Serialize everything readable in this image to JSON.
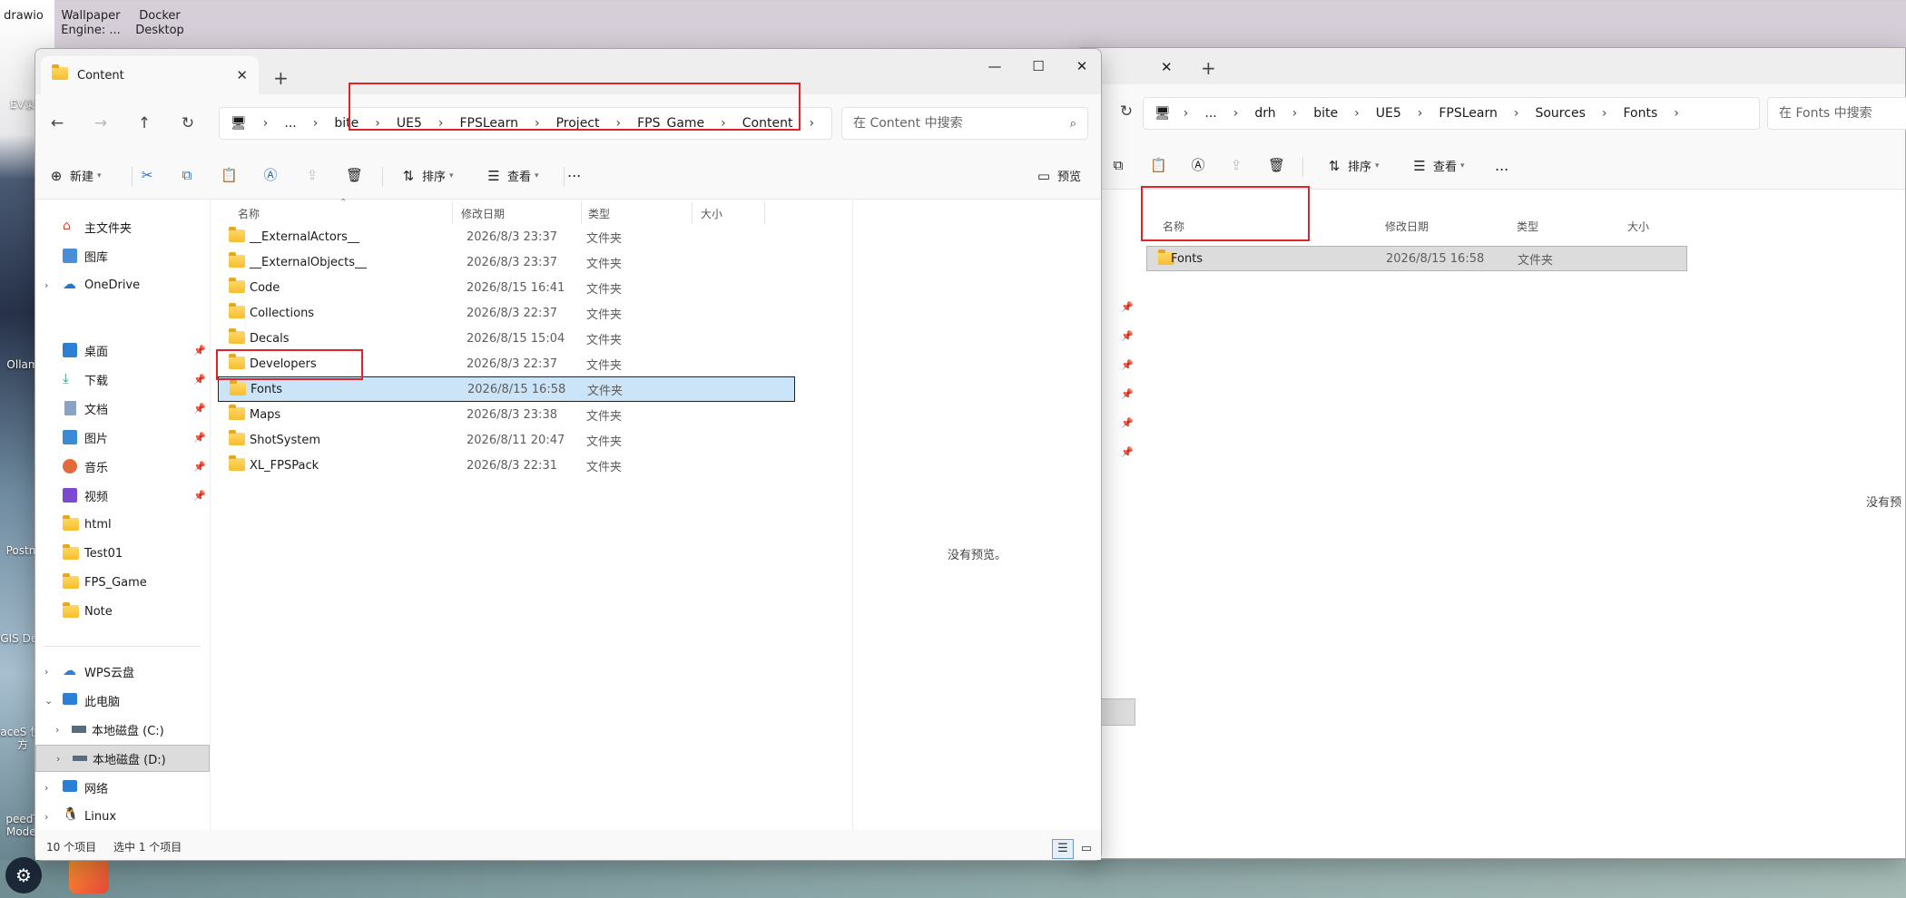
{
  "desktop": {
    "top_icons": [
      "drawio",
      "Wallpaper Engine: ...",
      "Docker Desktop"
    ],
    "left_labels": [
      "EV录",
      "Ollam",
      "Postm",
      "QGIS Deskt",
      "paceS 快捷方",
      "peedT Model"
    ]
  },
  "left_window": {
    "tab_title": "Content",
    "new_tab": "+",
    "window_controls": {
      "minimize": "—",
      "maximize": "☐",
      "close": "✕"
    },
    "breadcrumb": [
      "...",
      "bite",
      "UE5",
      "FPSLearn",
      "Project",
      "FPS_Game",
      "Content"
    ],
    "search_placeholder": "在 Content 中搜索",
    "toolbar": {
      "new": "新建",
      "sort": "排序",
      "view": "查看",
      "more": "...",
      "preview": "预览"
    },
    "sidebar": {
      "home": "主文件夹",
      "gallery": "图库",
      "onedrive": "OneDrive",
      "quick": [
        "桌面",
        "下载",
        "文档",
        "图片",
        "音乐",
        "视频",
        "html",
        "Test01",
        "FPS_Game",
        "Note"
      ],
      "wps": "WPS云盘",
      "this_pc": "此电脑",
      "drive_c": "本地磁盘 (C:)",
      "drive_d": "本地磁盘 (D:)",
      "network": "网络",
      "linux": "Linux"
    },
    "columns": {
      "name": "名称",
      "date": "修改日期",
      "type": "类型",
      "size": "大小"
    },
    "files": [
      {
        "name": "__ExternalActors__",
        "date": "2026/8/3 23:37",
        "type": "文件夹"
      },
      {
        "name": "__ExternalObjects__",
        "date": "2026/8/3 23:37",
        "type": "文件夹"
      },
      {
        "name": "Code",
        "date": "2026/8/15 16:41",
        "type": "文件夹"
      },
      {
        "name": "Collections",
        "date": "2026/8/3 22:37",
        "type": "文件夹"
      },
      {
        "name": "Decals",
        "date": "2026/8/15 15:04",
        "type": "文件夹"
      },
      {
        "name": "Developers",
        "date": "2026/8/3 22:37",
        "type": "文件夹"
      },
      {
        "name": "Fonts",
        "date": "2026/8/15 16:58",
        "type": "文件夹"
      },
      {
        "name": "Maps",
        "date": "2026/8/3 23:38",
        "type": "文件夹"
      },
      {
        "name": "ShotSystem",
        "date": "2026/8/11 20:47",
        "type": "文件夹"
      },
      {
        "name": "XL_FPSPack",
        "date": "2026/8/3 22:31",
        "type": "文件夹"
      }
    ],
    "preview_text": "没有预览。",
    "status": {
      "count": "10 个项目",
      "selected": "选中 1 个项目"
    }
  },
  "right_window": {
    "new_tab": "+",
    "close": "✕",
    "breadcrumb": [
      "...",
      "drh",
      "bite",
      "UE5",
      "FPSLearn",
      "Sources",
      "Fonts"
    ],
    "search_placeholder": "在 Fonts 中搜索",
    "toolbar": {
      "sort": "排序",
      "view": "查看",
      "more": "..."
    },
    "columns": {
      "name": "名称",
      "date": "修改日期",
      "type": "类型",
      "size": "大小"
    },
    "files": [
      {
        "name": "Fonts",
        "date": "2026/8/15 16:58",
        "type": "文件夹"
      }
    ],
    "preview_text": "没有预"
  }
}
